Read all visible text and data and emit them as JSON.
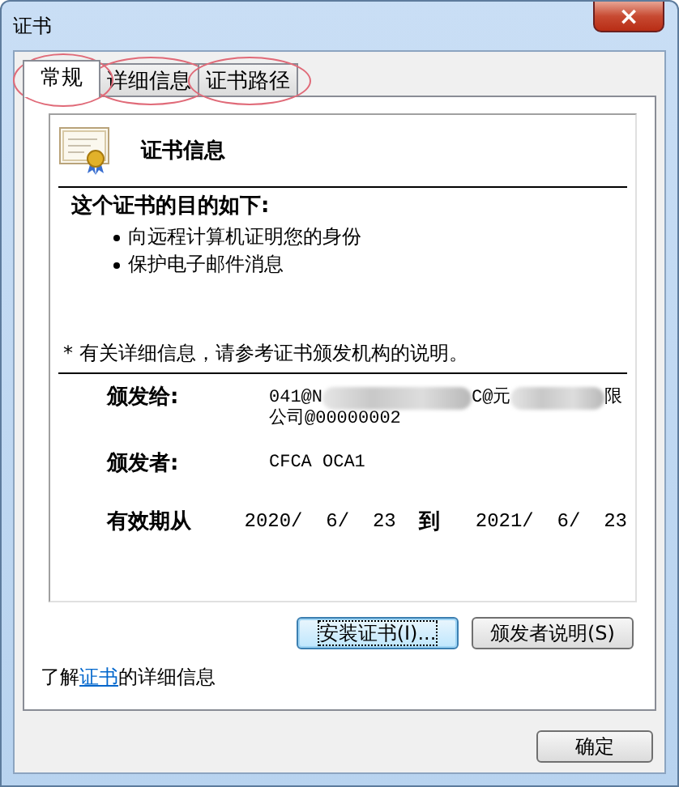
{
  "window": {
    "title": "证书",
    "close": "×"
  },
  "tabs": [
    {
      "label": "常规",
      "selected": true,
      "circled": true
    },
    {
      "label": "详细信息",
      "selected": false,
      "circled": true
    },
    {
      "label": "证书路径",
      "selected": false,
      "circled": true
    }
  ],
  "info": {
    "heading": "证书信息",
    "purpose_title": "这个证书的目的如下:",
    "purposes": [
      "向远程计算机证明您的身份",
      "保护电子邮件消息"
    ],
    "note": "* 有关详细信息，请参考证书颁发机构的说明。"
  },
  "fields": [
    {
      "label": "颁发给:",
      "parts": [
        "041@N",
        "C@元",
        "限"
      ],
      "line2": "公司@00000002"
    },
    {
      "label": "颁发者:",
      "parts": [
        "CFCA OCA1"
      ]
    }
  ],
  "validity": {
    "label": "有效期从",
    "from": "2020/  6/  23",
    "to_label": "到",
    "to": "2021/  6/  23"
  },
  "buttons": [
    {
      "label": "安装证书(I)...",
      "focused": true
    },
    {
      "label": "颁发者说明(S)",
      "focused": false
    }
  ],
  "link_line": {
    "before": "了解",
    "link": "证书",
    "after": "的详细信息"
  },
  "ok_button": "确定"
}
